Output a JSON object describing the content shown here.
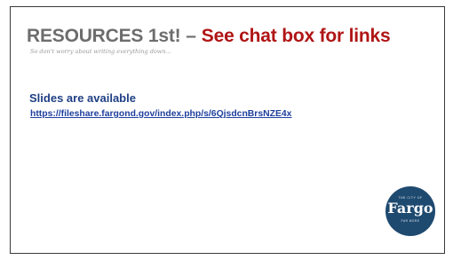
{
  "slide": {
    "title_main": "RESOURCES 1st!",
    "title_separator": "–",
    "title_accent": "See chat box for links",
    "note": "So don't worry about writing everything down...",
    "heading": "Slides are available",
    "link": "https://fileshare.fargond.gov/index.php/s/6QjsdcnBrsNZE4x"
  },
  "logo": {
    "top_text": "THE CITY OF",
    "word": "Fargo",
    "bottom_text": "FAR MORE"
  },
  "colors": {
    "title_gray": "#6d6d6d",
    "accent_red": "#b01515",
    "heading_blue": "#1f3f84",
    "link_blue": "#1f3f9e",
    "logo_navy": "#1f4a70"
  }
}
